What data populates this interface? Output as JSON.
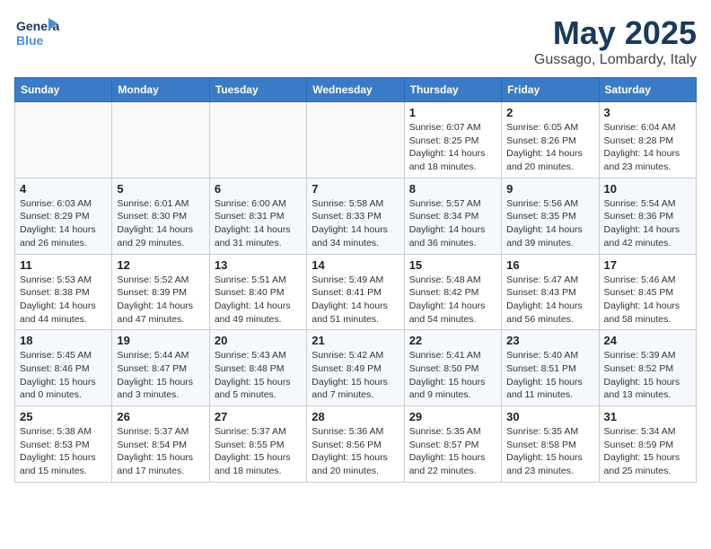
{
  "logo": {
    "line1": "General",
    "line2": "Blue"
  },
  "title": "May 2025",
  "location": "Gussago, Lombardy, Italy",
  "headers": [
    "Sunday",
    "Monday",
    "Tuesday",
    "Wednesday",
    "Thursday",
    "Friday",
    "Saturday"
  ],
  "weeks": [
    [
      {
        "day": "",
        "info": ""
      },
      {
        "day": "",
        "info": ""
      },
      {
        "day": "",
        "info": ""
      },
      {
        "day": "",
        "info": ""
      },
      {
        "day": "1",
        "info": "Sunrise: 6:07 AM\nSunset: 8:25 PM\nDaylight: 14 hours\nand 18 minutes."
      },
      {
        "day": "2",
        "info": "Sunrise: 6:05 AM\nSunset: 8:26 PM\nDaylight: 14 hours\nand 20 minutes."
      },
      {
        "day": "3",
        "info": "Sunrise: 6:04 AM\nSunset: 8:28 PM\nDaylight: 14 hours\nand 23 minutes."
      }
    ],
    [
      {
        "day": "4",
        "info": "Sunrise: 6:03 AM\nSunset: 8:29 PM\nDaylight: 14 hours\nand 26 minutes."
      },
      {
        "day": "5",
        "info": "Sunrise: 6:01 AM\nSunset: 8:30 PM\nDaylight: 14 hours\nand 29 minutes."
      },
      {
        "day": "6",
        "info": "Sunrise: 6:00 AM\nSunset: 8:31 PM\nDaylight: 14 hours\nand 31 minutes."
      },
      {
        "day": "7",
        "info": "Sunrise: 5:58 AM\nSunset: 8:33 PM\nDaylight: 14 hours\nand 34 minutes."
      },
      {
        "day": "8",
        "info": "Sunrise: 5:57 AM\nSunset: 8:34 PM\nDaylight: 14 hours\nand 36 minutes."
      },
      {
        "day": "9",
        "info": "Sunrise: 5:56 AM\nSunset: 8:35 PM\nDaylight: 14 hours\nand 39 minutes."
      },
      {
        "day": "10",
        "info": "Sunrise: 5:54 AM\nSunset: 8:36 PM\nDaylight: 14 hours\nand 42 minutes."
      }
    ],
    [
      {
        "day": "11",
        "info": "Sunrise: 5:53 AM\nSunset: 8:38 PM\nDaylight: 14 hours\nand 44 minutes."
      },
      {
        "day": "12",
        "info": "Sunrise: 5:52 AM\nSunset: 8:39 PM\nDaylight: 14 hours\nand 47 minutes."
      },
      {
        "day": "13",
        "info": "Sunrise: 5:51 AM\nSunset: 8:40 PM\nDaylight: 14 hours\nand 49 minutes."
      },
      {
        "day": "14",
        "info": "Sunrise: 5:49 AM\nSunset: 8:41 PM\nDaylight: 14 hours\nand 51 minutes."
      },
      {
        "day": "15",
        "info": "Sunrise: 5:48 AM\nSunset: 8:42 PM\nDaylight: 14 hours\nand 54 minutes."
      },
      {
        "day": "16",
        "info": "Sunrise: 5:47 AM\nSunset: 8:43 PM\nDaylight: 14 hours\nand 56 minutes."
      },
      {
        "day": "17",
        "info": "Sunrise: 5:46 AM\nSunset: 8:45 PM\nDaylight: 14 hours\nand 58 minutes."
      }
    ],
    [
      {
        "day": "18",
        "info": "Sunrise: 5:45 AM\nSunset: 8:46 PM\nDaylight: 15 hours\nand 0 minutes."
      },
      {
        "day": "19",
        "info": "Sunrise: 5:44 AM\nSunset: 8:47 PM\nDaylight: 15 hours\nand 3 minutes."
      },
      {
        "day": "20",
        "info": "Sunrise: 5:43 AM\nSunset: 8:48 PM\nDaylight: 15 hours\nand 5 minutes."
      },
      {
        "day": "21",
        "info": "Sunrise: 5:42 AM\nSunset: 8:49 PM\nDaylight: 15 hours\nand 7 minutes."
      },
      {
        "day": "22",
        "info": "Sunrise: 5:41 AM\nSunset: 8:50 PM\nDaylight: 15 hours\nand 9 minutes."
      },
      {
        "day": "23",
        "info": "Sunrise: 5:40 AM\nSunset: 8:51 PM\nDaylight: 15 hours\nand 11 minutes."
      },
      {
        "day": "24",
        "info": "Sunrise: 5:39 AM\nSunset: 8:52 PM\nDaylight: 15 hours\nand 13 minutes."
      }
    ],
    [
      {
        "day": "25",
        "info": "Sunrise: 5:38 AM\nSunset: 8:53 PM\nDaylight: 15 hours\nand 15 minutes."
      },
      {
        "day": "26",
        "info": "Sunrise: 5:37 AM\nSunset: 8:54 PM\nDaylight: 15 hours\nand 17 minutes."
      },
      {
        "day": "27",
        "info": "Sunrise: 5:37 AM\nSunset: 8:55 PM\nDaylight: 15 hours\nand 18 minutes."
      },
      {
        "day": "28",
        "info": "Sunrise: 5:36 AM\nSunset: 8:56 PM\nDaylight: 15 hours\nand 20 minutes."
      },
      {
        "day": "29",
        "info": "Sunrise: 5:35 AM\nSunset: 8:57 PM\nDaylight: 15 hours\nand 22 minutes."
      },
      {
        "day": "30",
        "info": "Sunrise: 5:35 AM\nSunset: 8:58 PM\nDaylight: 15 hours\nand 23 minutes."
      },
      {
        "day": "31",
        "info": "Sunrise: 5:34 AM\nSunset: 8:59 PM\nDaylight: 15 hours\nand 25 minutes."
      }
    ]
  ]
}
